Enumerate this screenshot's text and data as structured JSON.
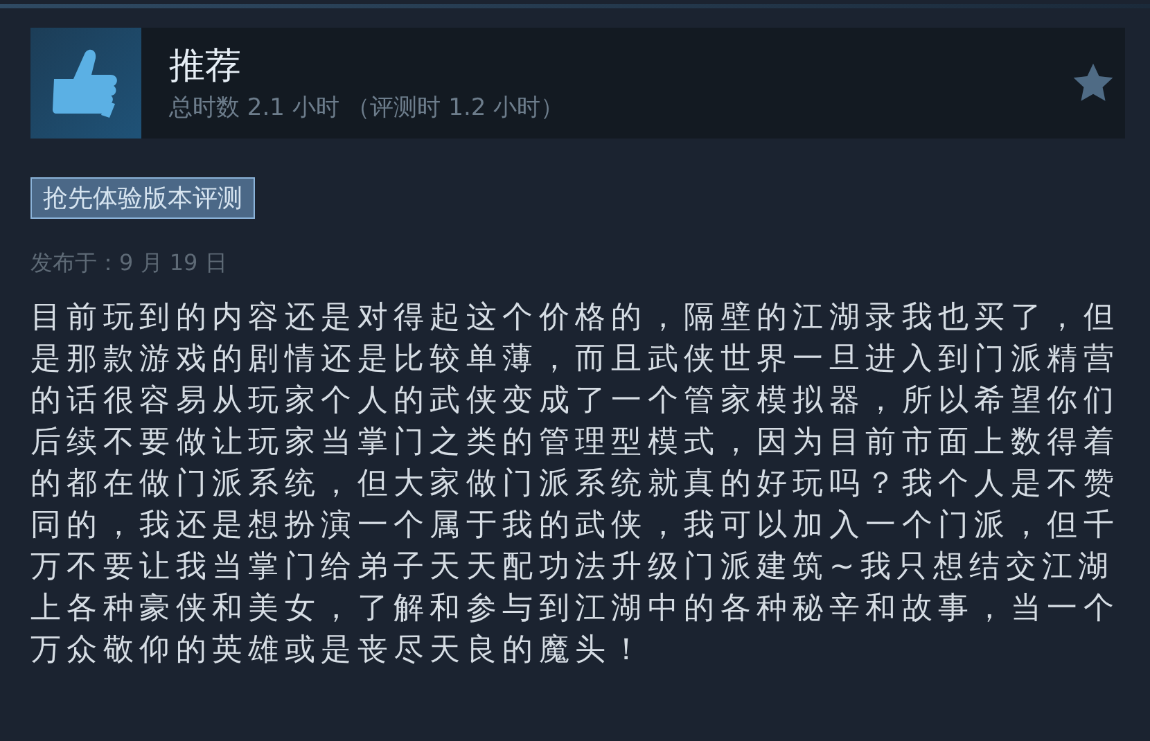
{
  "review": {
    "verdict": "推荐",
    "playtime": "总时数 2.1 小时 （评测时 1.2 小时）",
    "tag": "抢先体验版本评测",
    "posted": "发布于：9 月 19 日",
    "text": "目前玩到的内容还是对得起这个价格的，隔壁的江湖录我也买了，但是那款游戏的剧情还是比较单薄，而且武侠世界一旦进入到门派精营的话很容易从玩家个人的武侠变成了一个管家模拟器，所以希望你们后续不要做让玩家当掌门之类的管理型模式，因为目前市面上数得着的都在做门派系统，但大家做门派系统就真的好玩吗？我个人是不赞同的，我还是想扮演一个属于我的武侠，我可以加入一个门派，但千万不要让我当掌门给弟子天天配功法升级门派建筑~我只想结交江湖上各种豪侠和美女，了解和参与到江湖中的各种秘辛和故事，当一个万众敬仰的英雄或是丧尽天良的魔头！"
  }
}
